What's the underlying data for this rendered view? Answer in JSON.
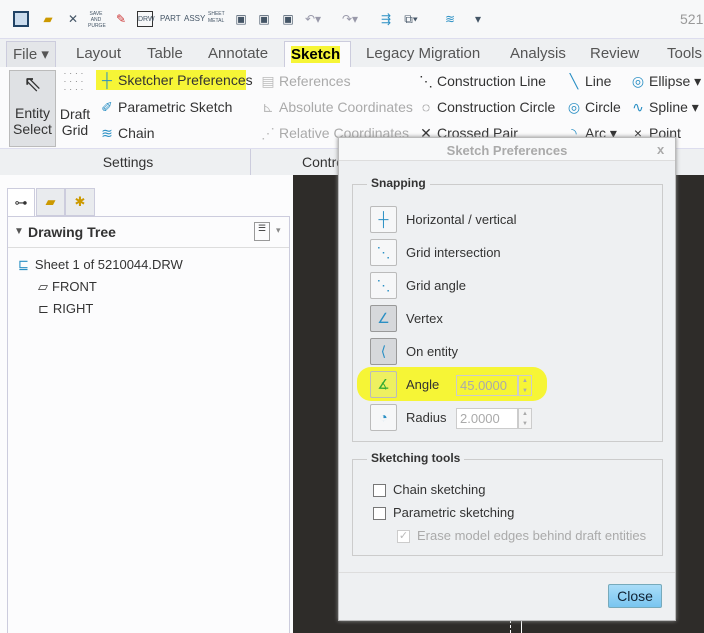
{
  "window": {
    "title_partial": "521"
  },
  "quick_access": [
    "app-icon",
    "open-icon",
    "close-window-icon",
    "save-and-purge-icon",
    "erase-icon",
    "drw-icon",
    "part-icon",
    "assy-icon",
    "sheet-metal-icon",
    "save-icon",
    "save-as-icon",
    "backup-icon",
    "undo-icon",
    "redo-icon",
    "regenerate-icon",
    "windows-icon",
    "layers-icon",
    "customize-icon"
  ],
  "quick_labels": {
    "save_purge": "SAVE AND PURGE",
    "drw": "DRW",
    "part": "PART",
    "assy": "ASSY",
    "sheet": "SHEET METAL"
  },
  "tabs": [
    {
      "label": "File"
    },
    {
      "label": "Layout"
    },
    {
      "label": "Table"
    },
    {
      "label": "Annotate"
    },
    {
      "label": "Sketch",
      "active": true
    },
    {
      "label": "Legacy Migration"
    },
    {
      "label": "Analysis"
    },
    {
      "label": "Review"
    },
    {
      "label": "Tools"
    }
  ],
  "ribbon": {
    "entity_select": [
      "Entity",
      "Select"
    ],
    "draft_grid": [
      "Draft",
      "Grid"
    ],
    "sketcher_preferences": "Sketcher Preferences",
    "parametric_sketch": "Parametric Sketch",
    "chain": "Chain",
    "references": "References",
    "absolute_coordinates": "Absolute Coordinates",
    "relative_coordinates": "Relative Coordinates",
    "construction_line": "Construction Line",
    "construction_circle": "Construction Circle",
    "crossed_pair": "Crossed Pair",
    "line": "Line",
    "ellipse": "Ellipse",
    "circle": "Circle",
    "spline": "Spline",
    "arc": "Arc",
    "point": "Point",
    "groups": {
      "settings": "Settings",
      "controls": "Contro"
    }
  },
  "left_panel": {
    "title": "Drawing Tree",
    "items": [
      {
        "label": "Sheet 1 of 5210044.DRW"
      },
      {
        "label": "FRONT"
      },
      {
        "label": "RIGHT"
      }
    ]
  },
  "dialog": {
    "title": "Sketch Preferences",
    "close": "x",
    "snapping": {
      "title": "Snapping",
      "items": [
        {
          "label": "Horizontal / vertical",
          "icon": "horizontal-vertical-icon",
          "on": false
        },
        {
          "label": "Grid intersection",
          "icon": "grid-intersection-icon",
          "on": false
        },
        {
          "label": "Grid angle",
          "icon": "grid-angle-icon",
          "on": false
        },
        {
          "label": "Vertex",
          "icon": "vertex-icon",
          "on": true
        },
        {
          "label": "On entity",
          "icon": "on-entity-icon",
          "on": true
        },
        {
          "label": "Angle",
          "icon": "angle-icon",
          "on": false,
          "value": "45.0000"
        },
        {
          "label": "Radius",
          "icon": "radius-icon",
          "on": false,
          "value": "2.0000"
        }
      ]
    },
    "sketching_tools": {
      "title": "Sketching tools",
      "chain": "Chain sketching",
      "chain_checked": false,
      "parametric": "Parametric sketching",
      "parametric_checked": false,
      "erase": "Erase model edges behind draft entities",
      "erase_checked": true,
      "erase_disabled": true
    },
    "close_button": "Close"
  },
  "colors": {
    "highlight": "#f6f536",
    "accent": "#2a8fc4",
    "canvas": "#2e2c29",
    "close_button": "#8fd0f5"
  }
}
